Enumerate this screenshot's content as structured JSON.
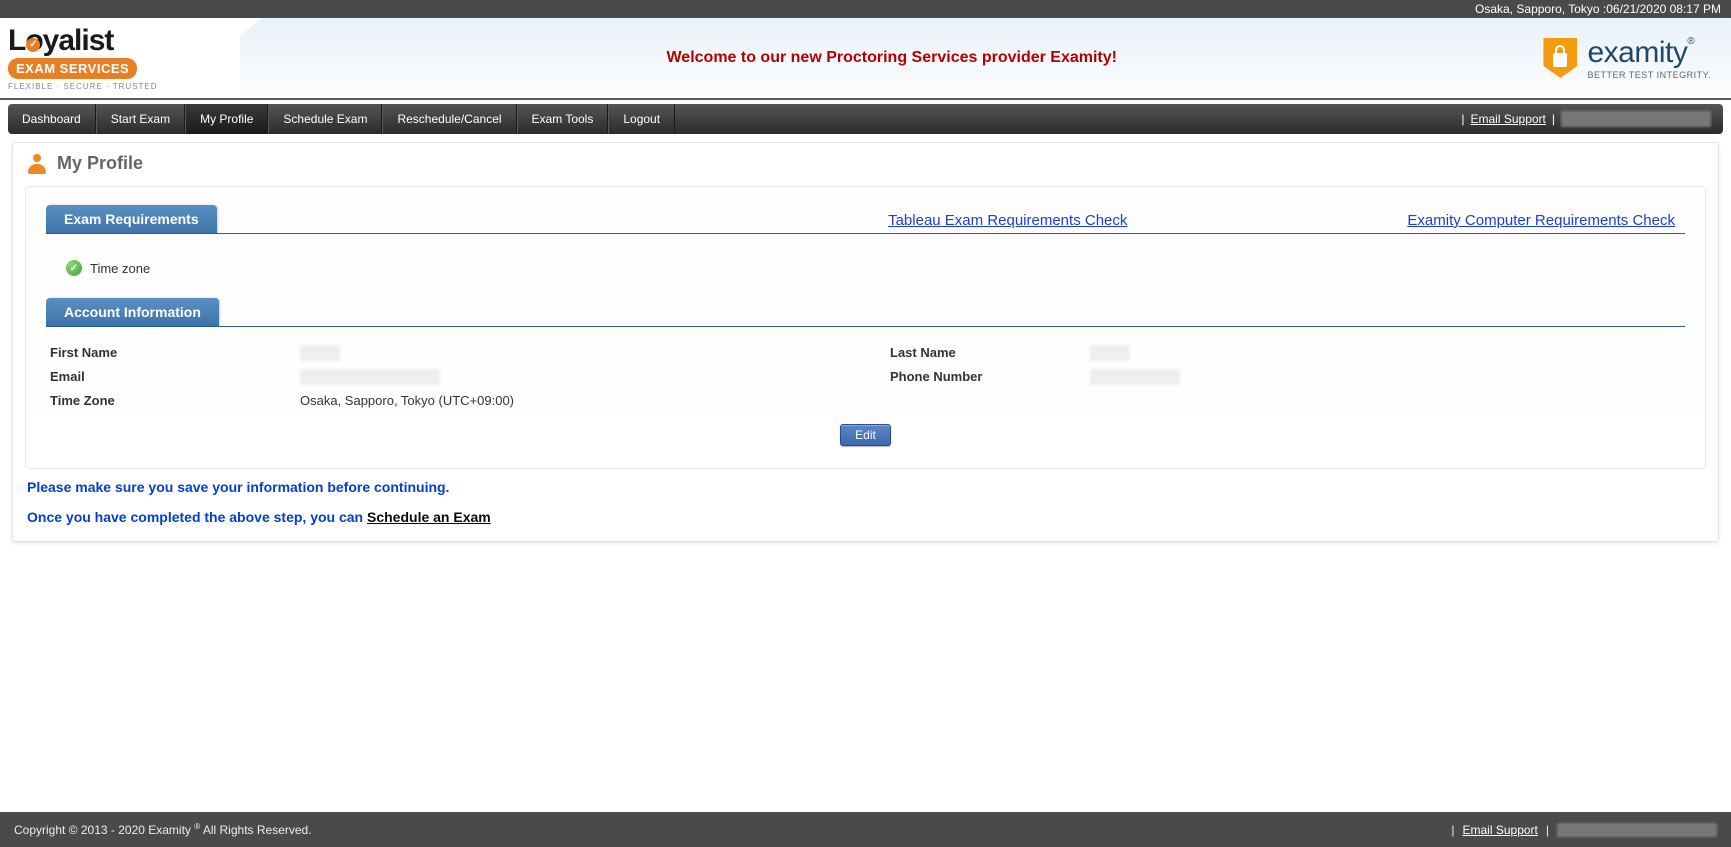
{
  "top_strip": {
    "datetime": "Osaka, Sapporo, Tokyo :06/21/2020 08:17 PM"
  },
  "logo": {
    "loyalist_main": "Loyalist",
    "loyalist_badge": "EXAM SERVICES",
    "loyalist_tag": "FLEXIBLE · SECURE · TRUSTED",
    "examity_word": "examity",
    "examity_reg": "®",
    "examity_tag": "BETTER TEST INTEGRITY."
  },
  "banner": {
    "welcome": "Welcome to our new Proctoring Services provider Examity!"
  },
  "nav": {
    "items": [
      "Dashboard",
      "Start Exam",
      "My Profile",
      "Schedule Exam",
      "Reschedule/Cancel",
      "Exam Tools",
      "Logout"
    ],
    "active_index": 2,
    "email_support": "Email Support",
    "pipe": "|"
  },
  "page": {
    "title": "My Profile"
  },
  "exam_req": {
    "tab": "Exam Requirements",
    "link1": "Tableau Exam Requirements Check",
    "link2": "Examity Computer Requirements Check",
    "timezone_item": "Time zone"
  },
  "account": {
    "tab": "Account Information",
    "labels": {
      "first_name": "First Name",
      "last_name": "Last Name",
      "email": "Email",
      "phone": "Phone Number",
      "timezone": "Time Zone"
    },
    "values": {
      "timezone": "Osaka, Sapporo, Tokyo (UTC+09:00)"
    },
    "edit": "Edit"
  },
  "notice": {
    "line1": "Please make sure you save your information before continuing.",
    "line2_prefix": "Once you have completed the above step, you can ",
    "line2_link": "Schedule an Exam"
  },
  "footer": {
    "copyright_prefix": "Copyright © 2013 - 2020 Examity ",
    "reg": "®",
    "copyright_suffix": "  All Rights Reserved.",
    "sep": "|",
    "email_support": "Email Support"
  }
}
